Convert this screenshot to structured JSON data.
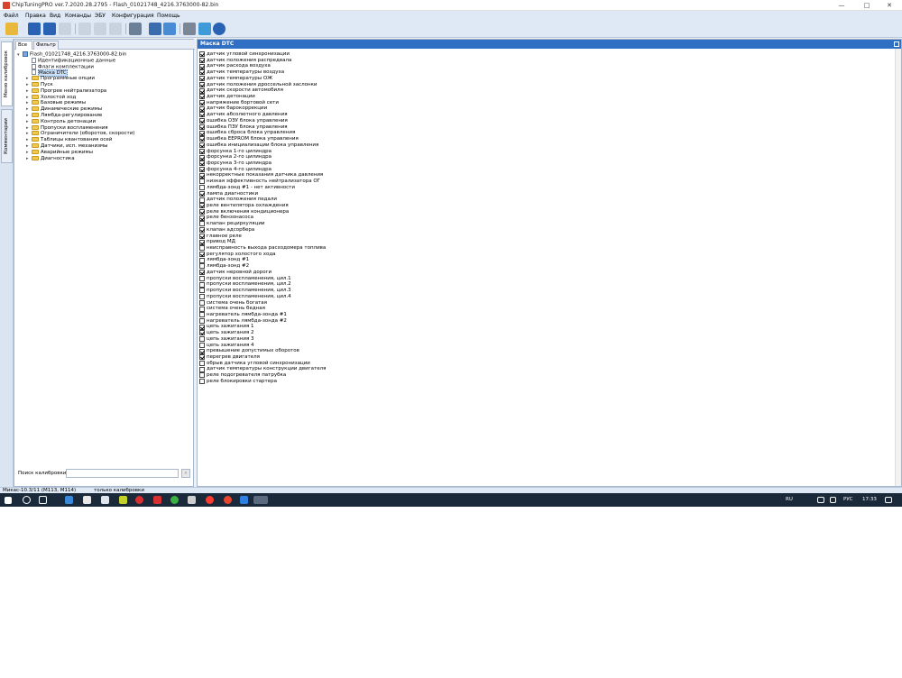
{
  "window": {
    "title": "ChipTuningPRO ver.7.2020.28.2795 - Flash_01021748_4216.3763000-82.bin",
    "minimize": "—",
    "maximize": "□",
    "close": "✕"
  },
  "menu": [
    "Файл",
    "Правка",
    "Вид",
    "Команды",
    "ЭБУ",
    "Конфигурация",
    "Помощь"
  ],
  "toolbar_icons": [
    "open-icon",
    "save-icon",
    "save-as-icon",
    "undo-icon",
    "copy-icon",
    "paste-icon",
    "redo-icon",
    "ecu-icon",
    "chip-icon",
    "search-icon",
    "transfer-icon",
    "checksum-icon",
    "network-icon",
    "help-icon"
  ],
  "vtabs": [
    "Меню калибровок",
    "Комментарии"
  ],
  "left": {
    "tabs": [
      "Все",
      "Фильтр"
    ],
    "root": "Flash_01021748_4216.3763000-82.bin",
    "docs": [
      "Идентификационные данные",
      "Флаги комплектации",
      "Маска DTC"
    ],
    "folders": [
      "Программные опции",
      "Пуск",
      "Прогрев нейтрализатора",
      "Холостой ход",
      "Базовые режимы",
      "Динамические режимы",
      "Лямбда-регулирование",
      "Контроль детонации",
      "Пропуски воспламенения",
      "Ограничители (оборотов, скорости)",
      "Таблицы квантования осей",
      "Датчики, исп. механизмы",
      "Аварийные режимы",
      "Диагностика"
    ],
    "search_label": "Поиск калибровки",
    "search_value": "",
    "search_button": "⌕"
  },
  "right": {
    "header": "Маска DTC",
    "items": [
      {
        "label": "датчик угловой синхронизации",
        "checked": true
      },
      {
        "label": "датчик положения распредвала",
        "checked": true
      },
      {
        "label": "датчик расхода воздуха",
        "checked": true
      },
      {
        "label": "датчик температуры воздуха",
        "checked": true
      },
      {
        "label": "датчик температуры ОЖ",
        "checked": true
      },
      {
        "label": "датчик положения дроссельной заслонки",
        "checked": true
      },
      {
        "label": "датчик скорости автомобиля",
        "checked": true
      },
      {
        "label": "датчик детонации",
        "checked": true
      },
      {
        "label": "напряжение бортовой сети",
        "checked": true
      },
      {
        "label": "датчик барокоррекции",
        "checked": true
      },
      {
        "label": "датчик абсолютного давления",
        "checked": true
      },
      {
        "label": "ошибка ОЗУ блока управления",
        "checked": true
      },
      {
        "label": "ошибка ПЗУ блока управления",
        "checked": true
      },
      {
        "label": "ошибка сброса блока управления",
        "checked": true
      },
      {
        "label": "ошибка EEPROM блока управления",
        "checked": true
      },
      {
        "label": "ошибка инициализации блока управления",
        "checked": true
      },
      {
        "label": "форсунка 1-го цилиндра",
        "checked": true
      },
      {
        "label": "форсунка 2-го цилиндра",
        "checked": true
      },
      {
        "label": "форсунка 3-го цилиндра",
        "checked": true
      },
      {
        "label": "форсунка 4-го цилиндра",
        "checked": true
      },
      {
        "label": "некорректные показания датчика давления",
        "checked": true
      },
      {
        "label": "низкая эффективность нейтрализатора ОГ",
        "checked": false
      },
      {
        "label": "лямбда-зонд #1 - нет активности",
        "checked": false
      },
      {
        "label": "лампа диагностики",
        "checked": true
      },
      {
        "label": "датчик положения педали",
        "checked": false
      },
      {
        "label": "реле вентилятора охлаждения",
        "checked": true
      },
      {
        "label": "реле включения кондиционера",
        "checked": true
      },
      {
        "label": "реле бензонасоса",
        "checked": true
      },
      {
        "label": "клапан рециркуляции",
        "checked": false
      },
      {
        "label": "клапан адсорбера",
        "checked": true
      },
      {
        "label": "главное реле",
        "checked": true
      },
      {
        "label": "привод МД",
        "checked": true
      },
      {
        "label": "неисправность выхода расходомера топлива",
        "checked": false
      },
      {
        "label": "регулятор холостого хода",
        "checked": true
      },
      {
        "label": "лямбда-зонд #1",
        "checked": false
      },
      {
        "label": "лямбда-зонд #2",
        "checked": false
      },
      {
        "label": "датчик неровной дороги",
        "checked": true
      },
      {
        "label": "пропуски воспламенения, цил.1",
        "checked": false
      },
      {
        "label": "пропуски воспламенения, цил.2",
        "checked": false
      },
      {
        "label": "пропуски воспламенения, цил.3",
        "checked": false
      },
      {
        "label": "пропуски воспламенения, цил.4",
        "checked": false
      },
      {
        "label": "система очень богатая",
        "checked": false
      },
      {
        "label": "система очень бедная",
        "checked": false
      },
      {
        "label": "нагреватель лямбда-зонда #1",
        "checked": false
      },
      {
        "label": "нагреватель лямбда-зонда #2",
        "checked": false
      },
      {
        "label": "цепь зажигания 1",
        "checked": true
      },
      {
        "label": "цепь зажигания 2",
        "checked": true
      },
      {
        "label": "цепь зажигания 3",
        "checked": false
      },
      {
        "label": "цепь зажигания 4",
        "checked": false
      },
      {
        "label": "превышение допустимых оборотов",
        "checked": true
      },
      {
        "label": "перегрев двигателя",
        "checked": true
      },
      {
        "label": "обрыв датчика угловой синхронизации",
        "checked": false
      },
      {
        "label": "датчик температуры конструкции двигателя",
        "checked": false
      },
      {
        "label": "реле подогревателя патрубка",
        "checked": false
      },
      {
        "label": "реле блокировки стартера",
        "checked": false
      }
    ]
  },
  "status": {
    "left": "Микас-10.3/11 (M113, M114)",
    "right": "только калибровки"
  },
  "taskbar": {
    "lang": "RU",
    "kbd": "РУС",
    "time": "17:33"
  }
}
